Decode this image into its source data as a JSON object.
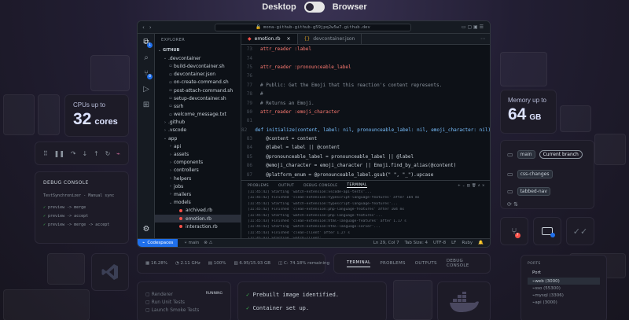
{
  "toggle": {
    "left": "Desktop",
    "right": "Browser"
  },
  "cpu_card": {
    "label": "CPUs up to",
    "value": "32",
    "unit": "cores"
  },
  "memory_card": {
    "label": "Memory up to",
    "value": "64",
    "unit": "GB"
  },
  "editor": {
    "url": "mona-github-github-g59jpq2w5w7.github.dev",
    "explorer_label": "EXPLORER",
    "repo_label": "GITHUB",
    "tree": [
      {
        "label": ".devcontainer",
        "depth": 1,
        "type": "folder-open"
      },
      {
        "label": "build-devcontainer.sh",
        "depth": 2,
        "type": "file"
      },
      {
        "label": "devcontainer.json",
        "depth": 2,
        "type": "file"
      },
      {
        "label": "on-create-command.sh",
        "depth": 2,
        "type": "file"
      },
      {
        "label": "post-attach-command.sh",
        "depth": 2,
        "type": "file"
      },
      {
        "label": "setup-devcontainer.sh",
        "depth": 2,
        "type": "file"
      },
      {
        "label": "ssrh",
        "depth": 2,
        "type": "file"
      },
      {
        "label": "welcome_message.txt",
        "depth": 2,
        "type": "file"
      },
      {
        "label": ".github",
        "depth": 1,
        "type": "folder"
      },
      {
        "label": ".vscode",
        "depth": 1,
        "type": "folder"
      },
      {
        "label": "app",
        "depth": 1,
        "type": "folder-open"
      },
      {
        "label": "api",
        "depth": 2,
        "type": "folder"
      },
      {
        "label": "assets",
        "depth": 2,
        "type": "folder"
      },
      {
        "label": "components",
        "depth": 2,
        "type": "folder"
      },
      {
        "label": "controllers",
        "depth": 2,
        "type": "folder"
      },
      {
        "label": "helpers",
        "depth": 2,
        "type": "folder"
      },
      {
        "label": "jobs",
        "depth": 2,
        "type": "folder"
      },
      {
        "label": "mailers",
        "depth": 2,
        "type": "folder"
      },
      {
        "label": "models",
        "depth": 2,
        "type": "folder-open"
      },
      {
        "label": "archived.rb",
        "depth": 3,
        "type": "ruby"
      },
      {
        "label": "emotion.rb",
        "depth": 3,
        "type": "ruby",
        "selected": true
      },
      {
        "label": "interaction.rb",
        "depth": 3,
        "type": "ruby"
      }
    ],
    "tabs": [
      {
        "label": "emotion.rb",
        "active": true
      },
      {
        "label": "devcontainer.json",
        "active": false
      }
    ],
    "code": [
      {
        "n": "73",
        "text": "attr_reader :label",
        "kind": "kw"
      },
      {
        "n": "74",
        "text": "",
        "kind": "plain"
      },
      {
        "n": "75",
        "text": "attr_reader :pronounceable_label",
        "kind": "kw"
      },
      {
        "n": "76",
        "text": "",
        "kind": "plain"
      },
      {
        "n": "77",
        "text": "# Public: Get the Emoji that this reaction's content represents.",
        "kind": "comment"
      },
      {
        "n": "78",
        "text": "#",
        "kind": "comment"
      },
      {
        "n": "79",
        "text": "# Returns an Emoji.",
        "kind": "comment"
      },
      {
        "n": "80",
        "text": "attr_reader :emoji_character",
        "kind": "kw"
      },
      {
        "n": "81",
        "text": "",
        "kind": "plain"
      },
      {
        "n": "82",
        "text": "def initialize(content, label: nil, pronounceable_label: nil, emoji_character: nil)",
        "kind": "def"
      },
      {
        "n": "83",
        "text": "  @content = content",
        "kind": "plain"
      },
      {
        "n": "84",
        "text": "  @label = label || @content",
        "kind": "plain"
      },
      {
        "n": "85",
        "text": "  @pronounceable_label = pronounceable_label || @label",
        "kind": "plain"
      },
      {
        "n": "86",
        "text": "  @emoji_character = emoji_character || Emoji.find_by_alias(@content)",
        "kind": "plain"
      },
      {
        "n": "87",
        "text": "  @platform_enum = @pronounceable_label.gsub(\" \", \"_\").upcase",
        "kind": "plain"
      }
    ],
    "panel_tabs": [
      {
        "label": "PROBLEMS",
        "active": false
      },
      {
        "label": "OUTPUT",
        "active": false
      },
      {
        "label": "DEBUG CONSOLE",
        "active": false
      },
      {
        "label": "TERMINAL",
        "active": true
      }
    ],
    "terminal": [
      "[11:45:42] Starting 'watch-extension:vscode-api-tests'...",
      "[11:45:42] Finished 'clean-extension:typescript-language-features' after 184 ms",
      "[11:45:42] Starting 'watch-extension:typescript-language-features'...",
      "[11:45:42] Finished 'clean-extension:php-language-features' after 104 ms",
      "[11:45:42] Starting 'watch-extension:php-language-features'...",
      "[11:45:43] Finished 'clean-extension:html-language-features' after 1.17 s",
      "[11:45:43] Starting 'watch-extension:html-language-server'...",
      "[11:45:43] Finished 'clean-client' after 1.27 s",
      "[11:45:43] Starting 'watch-client'...",
      "[11:45:45] Starting monaco.d.ts generation",
      "[11:45:46] Finished monaco.d.ts generation"
    ],
    "status": {
      "codespaces": "Codespaces",
      "branch": "main",
      "right": [
        "Ln 29, Col 7",
        "Tab Size: 4",
        "UTF-8",
        "LF",
        "Ruby"
      ]
    }
  },
  "debug_card": {
    "title": "DEBUG CONSOLE",
    "subtitle": "TestSynchronizer - Manual sync",
    "lines": [
      "preview -> merge",
      "preview -> accept",
      "preview -> merge -> accept"
    ]
  },
  "branches": [
    {
      "label": "main",
      "extra": "Current branch"
    },
    {
      "label": "css-changes",
      "extra": ""
    },
    {
      "label": "tabbed-nav",
      "extra": ""
    }
  ],
  "metrics": {
    "cpu": "16.28%",
    "ghz": "2.11 GHz",
    "mem": "100%",
    "ram": "6.95/15.93 GB",
    "disk": "C: 74.18% remaining"
  },
  "bottom_panel_tabs": [
    "TERMINAL",
    "PROBLEMS",
    "OUTPUTS",
    "DEBUG CONSOLE"
  ],
  "tasks": {
    "items": [
      "Renderer",
      "Run Unit Tests",
      "Launch Smoke Tests"
    ],
    "status": "RUNNING"
  },
  "terminal_card": {
    "lines": [
      "Prebuilt image identified.",
      "Container set up."
    ]
  },
  "ports": {
    "title": "PORTS",
    "header": "Port",
    "rows": [
      "web (3000)",
      "sso (55300)",
      "mysql (3306)",
      "api (3000)"
    ]
  },
  "colors": {
    "accent": "#1f6feb",
    "keyword": "#ff7b72",
    "symbol": "#79c0ff",
    "comment": "#8b949e",
    "ruby": "#f85149"
  }
}
